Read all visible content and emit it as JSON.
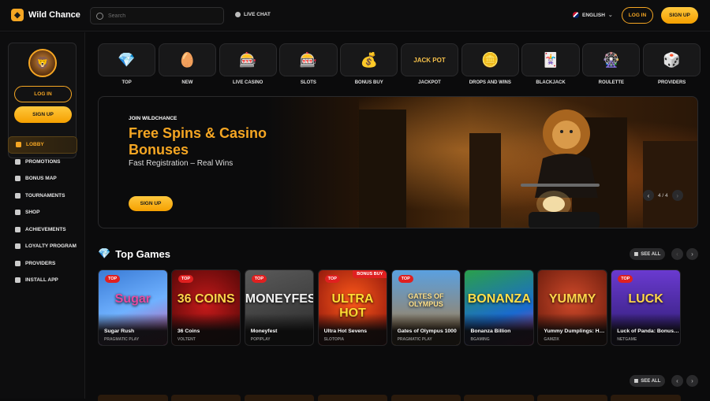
{
  "header": {
    "brand": "Wild Chance",
    "search_placeholder": "Search",
    "live_chat": "LIVE CHAT",
    "language": "ENGLISH",
    "login": "LOG IN",
    "signup": "SIGN UP"
  },
  "sidebar": {
    "login": "LOG IN",
    "signup": "SIGN UP",
    "items": [
      {
        "label": "LOBBY",
        "icon": "lobby-icon",
        "active": true
      },
      {
        "label": "PROMOTIONS",
        "icon": "megaphone-icon"
      },
      {
        "label": "BONUS MAP",
        "icon": "map-icon"
      },
      {
        "label": "TOURNAMENTS",
        "icon": "trophy-icon"
      },
      {
        "label": "SHOP",
        "icon": "shop-icon"
      },
      {
        "label": "ACHIEVEMENTS",
        "icon": "crown-icon"
      },
      {
        "label": "LOYALTY PROGRAM",
        "icon": "diamond-icon"
      },
      {
        "label": "PROVIDERS",
        "icon": "grid-icon"
      },
      {
        "label": "INSTALL APP",
        "icon": "download-icon"
      }
    ]
  },
  "categories": [
    {
      "label": "TOP",
      "icon": "diamond-icon",
      "glyph": "💎"
    },
    {
      "label": "NEW",
      "icon": "chip-new-icon",
      "glyph": "🥚"
    },
    {
      "label": "LIVE CASINO",
      "icon": "live-casino-icon",
      "glyph": "🎰"
    },
    {
      "label": "SLOTS",
      "icon": "slot-machine-icon",
      "glyph": "🎰"
    },
    {
      "label": "BONUS BUY",
      "icon": "money-bag-icon",
      "glyph": "💰"
    },
    {
      "label": "JACKPOT",
      "icon": "jackpot-icon",
      "glyph": "JACK POT"
    },
    {
      "label": "DROPS AND WINS",
      "icon": "coin-icon",
      "glyph": "🪙"
    },
    {
      "label": "BLACKJACK",
      "icon": "cards-icon",
      "glyph": "🃏"
    },
    {
      "label": "ROULETTE",
      "icon": "roulette-icon",
      "glyph": "🎡"
    },
    {
      "label": "PROVIDERS",
      "icon": "dice-icon",
      "glyph": "🎲"
    }
  ],
  "hero": {
    "kicker": "JOIN WILDCHANCE",
    "title": "Free Spins & Casino Bonuses",
    "subtitle": "Fast Registration – Real Wins",
    "button": "SIGN UP",
    "pager": "4 / 4"
  },
  "top_games": {
    "title": "Top Games",
    "see_all": "SEE ALL",
    "games": [
      {
        "name": "Sugar Rush",
        "provider": "PRAGMATIC PLAY",
        "tag": "TOP",
        "art": "Sugar",
        "art_color": "#e64aa0",
        "bg": "linear-gradient(160deg,#3a7bd5,#6fb1ff 50%,#d94f9f)"
      },
      {
        "name": "36 Coins",
        "provider": "VOLTENT",
        "tag": "TOP",
        "art": "36 COINS",
        "art_color": "#ffd54a",
        "bg": "radial-gradient(circle at 50% 45%,#c61a1a,#4a0606)"
      },
      {
        "name": "Moneyfest",
        "provider": "POPIPLAY",
        "tag": "TOP",
        "art": "MONEYFEST",
        "art_color": "#f0f0f0",
        "bg": "linear-gradient(160deg,#5a5a5a,#2a2a2a)"
      },
      {
        "name": "Ultra Hot Sevens",
        "provider": "SLOTOPIA",
        "tag": "TOP",
        "bonus": "BONUS BUY",
        "art": "ULTRA HOT",
        "art_color": "#ffdd33",
        "bg": "radial-gradient(circle at 50% 40%,#ff5a1a,#7a0a0a)"
      },
      {
        "name": "Gates of Olympus 1000",
        "provider": "PRAGMATIC PLAY",
        "tag": "TOP",
        "art": "GATES OF OLYMPUS",
        "art_color": "#ffe08a",
        "bg": "linear-gradient(180deg,#5aa0e0,#b07a3a)"
      },
      {
        "name": "Bonanza Billion",
        "provider": "BGAMING",
        "tag": "",
        "art": "BONANZA",
        "art_color": "#ffe04a",
        "bg": "linear-gradient(160deg,#2aa04a,#1a6ad0 60%,#d0308a)"
      },
      {
        "name": "Yummy Dumplings: Ho…",
        "provider": "GAMZIX",
        "tag": "",
        "art": "YUMMY",
        "art_color": "#ffd54a",
        "bg": "radial-gradient(circle at 50% 40%,#d04a2a,#5a1408)"
      },
      {
        "name": "Luck of Panda: Bonus…",
        "provider": "NETGAME",
        "tag": "TOP",
        "art": "LUCK",
        "art_color": "#ffd54a",
        "bg": "linear-gradient(180deg,#6a3ad0,#2a1a6a)"
      }
    ]
  },
  "second_row": {
    "see_all": "SEE ALL"
  },
  "colors": {
    "accent": "#f5a623",
    "tag_red": "#e02020",
    "bg": "#0b0b0c"
  }
}
